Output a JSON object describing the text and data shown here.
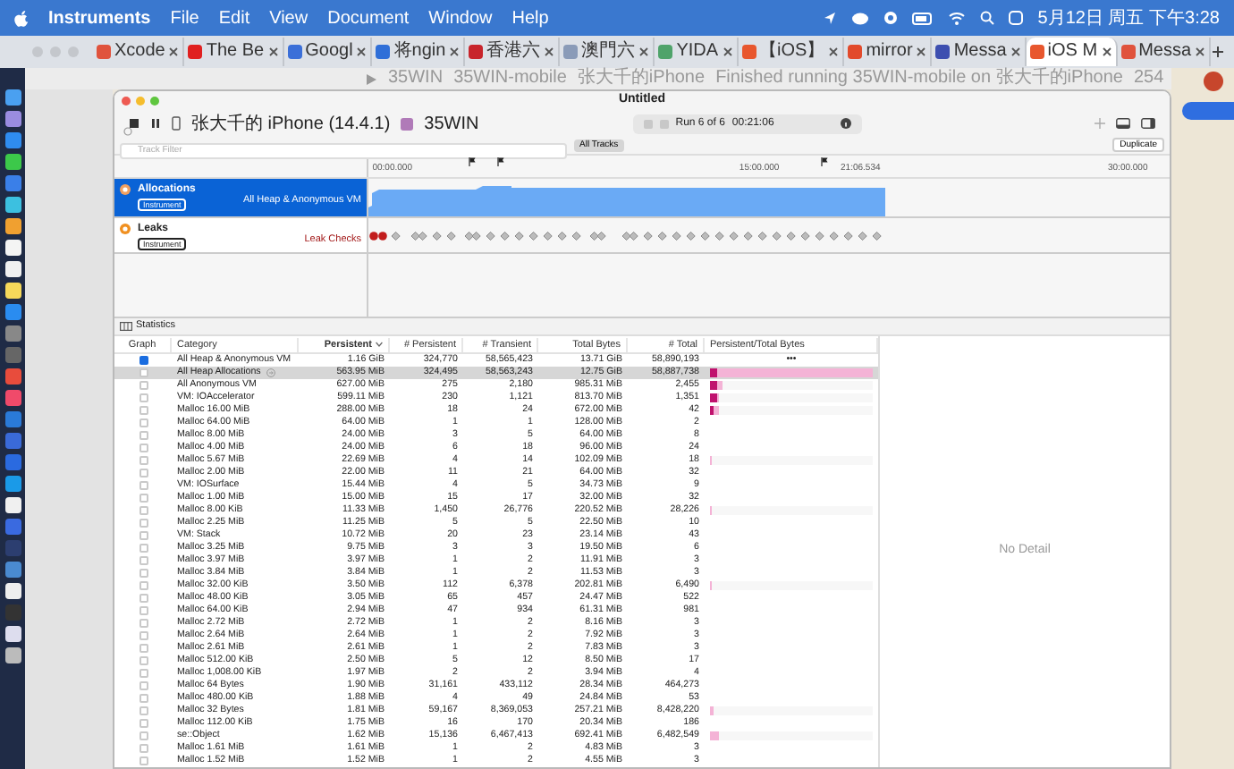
{
  "menu_bar": {
    "app": "Instruments",
    "menus": [
      "File",
      "Edit",
      "View",
      "Document",
      "Window",
      "Help"
    ],
    "clock": "5月12日 周五 下午3:28"
  },
  "browser_tabs": [
    {
      "label": "Xcode",
      "color": "#e0533d",
      "selected": false
    },
    {
      "label": "The Be",
      "color": "#e02020",
      "selected": false
    },
    {
      "label": "Googl",
      "color": "#3b6fd8",
      "selected": false
    },
    {
      "label": "将ngin",
      "color": "#2f6fd8",
      "selected": false
    },
    {
      "label": "香港六",
      "color": "#c8252c",
      "selected": false
    },
    {
      "label": "澳門六",
      "color": "#8a9bb8",
      "selected": false
    },
    {
      "label": "YIDA",
      "color": "#4fa36a",
      "selected": false
    },
    {
      "label": "【iOS】",
      "color": "#e8572e",
      "selected": false
    },
    {
      "label": "mirror",
      "color": "#e24a2b",
      "selected": false
    },
    {
      "label": "Messa",
      "color": "#3d4fb0",
      "selected": false
    },
    {
      "label": "iOS M",
      "color": "#e8572e",
      "selected": true
    },
    {
      "label": "Messa",
      "color": "#e0533d",
      "selected": false
    }
  ],
  "xcode_toolbar": {
    "scheme": "35WIN",
    "breadcrumb": [
      "35WIN-mobile",
      "张大千的iPhone"
    ],
    "status": "Finished running 35WIN-mobile on 张大千的iPhone",
    "warnings": "254"
  },
  "window": {
    "title": "Untitled"
  },
  "toolbar": {
    "device": "张大千的 iPhone (14.4.1)",
    "app": "35WIN",
    "run": "Run 6 of 6",
    "elapsed": "00:21:06"
  },
  "track_filter": {
    "placeholder": "Track Filter"
  },
  "scope_button": "All Tracks",
  "duplicate_button": "Duplicate",
  "ruler": [
    "00:00.000",
    "15:00.000",
    "21:06.534",
    "30:00.000"
  ],
  "tracks": [
    {
      "kind": "allocations",
      "name": "Allocations",
      "badge": "Instrument",
      "label": "All Heap & Anonymous VM",
      "selected": true
    },
    {
      "kind": "leaks",
      "name": "Leaks",
      "badge": "Instrument",
      "label": "Leak Checks",
      "selected": false
    }
  ],
  "detail_view": "Statistics",
  "table": {
    "columns": [
      {
        "label": "Graph",
        "sorted": false
      },
      {
        "label": "Category",
        "sorted": false
      },
      {
        "label": "Persistent",
        "sorted": true
      },
      {
        "label": "# Persistent",
        "sorted": false
      },
      {
        "label": "# Transient",
        "sorted": false
      },
      {
        "label": "Total Bytes",
        "sorted": false
      },
      {
        "label": "# Total",
        "sorted": false
      },
      {
        "label": "Persistent/Total Bytes",
        "sorted": false
      }
    ],
    "rows": [
      {
        "graph_checked": true,
        "selected": false,
        "category": "All Heap & Anonymous VM",
        "persistent": "1.16 GiB",
        "persistent_count": "324,770",
        "transient_count": "58,565,423",
        "total_bytes": "13.71 GiB",
        "total_count": "58,890,193",
        "bar_text": "•••"
      },
      {
        "graph_checked": false,
        "selected": true,
        "category": "All Heap Allocations",
        "persistent": "563.95 MiB",
        "persistent_count": "324,495",
        "transient_count": "58,563,243",
        "total_bytes": "12.75 GiB",
        "total_count": "58,887,738",
        "bar": {
          "persistent": {
            "level": 0.04
          },
          "total": {
            "level": 1
          }
        }
      },
      {
        "graph_checked": false,
        "selected": false,
        "category": "All Anonymous VM",
        "persistent": "627.00 MiB",
        "persistent_count": "275",
        "transient_count": "2,180",
        "total_bytes": "985.31 MiB",
        "total_count": "2,455",
        "bar": {
          "persistent": {
            "level": 0.04
          },
          "total": {
            "level": 0.08
          }
        }
      },
      {
        "graph_checked": false,
        "selected": false,
        "category": "VM: IOAccelerator",
        "persistent": "599.11 MiB",
        "persistent_count": "230",
        "transient_count": "1,121",
        "total_bytes": "813.70 MiB",
        "total_count": "1,351",
        "bar": {
          "persistent": {
            "level": 0.04
          },
          "total": {
            "level": 0.06
          }
        }
      },
      {
        "graph_checked": false,
        "selected": false,
        "category": "Malloc 16.00 MiB",
        "persistent": "288.00 MiB",
        "persistent_count": "18",
        "transient_count": "24",
        "total_bytes": "672.00 MiB",
        "total_count": "42",
        "bar": {
          "persistent": {
            "level": 0.02
          },
          "total": {
            "level": 0.06
          }
        }
      },
      {
        "graph_checked": false,
        "selected": false,
        "category": "Malloc 64.00 MiB",
        "persistent": "64.00 MiB",
        "persistent_count": "1",
        "transient_count": "1",
        "total_bytes": "128.00 MiB",
        "total_count": "2"
      },
      {
        "graph_checked": false,
        "selected": false,
        "category": "Malloc 8.00 MiB",
        "persistent": "24.00 MiB",
        "persistent_count": "3",
        "transient_count": "5",
        "total_bytes": "64.00 MiB",
        "total_count": "8"
      },
      {
        "graph_checked": false,
        "selected": false,
        "category": "Malloc 4.00 MiB",
        "persistent": "24.00 MiB",
        "persistent_count": "6",
        "transient_count": "18",
        "total_bytes": "96.00 MiB",
        "total_count": "24"
      },
      {
        "graph_checked": false,
        "selected": false,
        "category": "Malloc 5.67 MiB",
        "persistent": "22.69 MiB",
        "persistent_count": "4",
        "transient_count": "14",
        "total_bytes": "102.09 MiB",
        "total_count": "18",
        "bar": {
          "total": {
            "level": 0.01
          }
        }
      },
      {
        "graph_checked": false,
        "selected": false,
        "category": "Malloc 2.00 MiB",
        "persistent": "22.00 MiB",
        "persistent_count": "11",
        "transient_count": "21",
        "total_bytes": "64.00 MiB",
        "total_count": "32"
      },
      {
        "graph_checked": false,
        "selected": false,
        "category": "VM: IOSurface",
        "persistent": "15.44 MiB",
        "persistent_count": "4",
        "transient_count": "5",
        "total_bytes": "34.73 MiB",
        "total_count": "9"
      },
      {
        "graph_checked": false,
        "selected": false,
        "category": "Malloc 1.00 MiB",
        "persistent": "15.00 MiB",
        "persistent_count": "15",
        "transient_count": "17",
        "total_bytes": "32.00 MiB",
        "total_count": "32"
      },
      {
        "graph_checked": false,
        "selected": false,
        "category": "Malloc 8.00 KiB",
        "persistent": "11.33 MiB",
        "persistent_count": "1,450",
        "transient_count": "26,776",
        "total_bytes": "220.52 MiB",
        "total_count": "28,226",
        "bar": {
          "total": {
            "level": 0.01
          }
        }
      },
      {
        "graph_checked": false,
        "selected": false,
        "category": "Malloc 2.25 MiB",
        "persistent": "11.25 MiB",
        "persistent_count": "5",
        "transient_count": "5",
        "total_bytes": "22.50 MiB",
        "total_count": "10"
      },
      {
        "graph_checked": false,
        "selected": false,
        "category": "VM: Stack",
        "persistent": "10.72 MiB",
        "persistent_count": "20",
        "transient_count": "23",
        "total_bytes": "23.14 MiB",
        "total_count": "43"
      },
      {
        "graph_checked": false,
        "selected": false,
        "category": "Malloc 3.25 MiB",
        "persistent": "9.75 MiB",
        "persistent_count": "3",
        "transient_count": "3",
        "total_bytes": "19.50 MiB",
        "total_count": "6"
      },
      {
        "graph_checked": false,
        "selected": false,
        "category": "Malloc 3.97 MiB",
        "persistent": "3.97 MiB",
        "persistent_count": "1",
        "transient_count": "2",
        "total_bytes": "11.91 MiB",
        "total_count": "3"
      },
      {
        "graph_checked": false,
        "selected": false,
        "category": "Malloc 3.84 MiB",
        "persistent": "3.84 MiB",
        "persistent_count": "1",
        "transient_count": "2",
        "total_bytes": "11.53 MiB",
        "total_count": "3"
      },
      {
        "graph_checked": false,
        "selected": false,
        "category": "Malloc 32.00 KiB",
        "persistent": "3.50 MiB",
        "persistent_count": "112",
        "transient_count": "6,378",
        "total_bytes": "202.81 MiB",
        "total_count": "6,490",
        "bar": {
          "total": {
            "level": 0.015
          }
        }
      },
      {
        "graph_checked": false,
        "selected": false,
        "category": "Malloc 48.00 KiB",
        "persistent": "3.05 MiB",
        "persistent_count": "65",
        "transient_count": "457",
        "total_bytes": "24.47 MiB",
        "total_count": "522"
      },
      {
        "graph_checked": false,
        "selected": false,
        "category": "Malloc 64.00 KiB",
        "persistent": "2.94 MiB",
        "persistent_count": "47",
        "transient_count": "934",
        "total_bytes": "61.31 MiB",
        "total_count": "981"
      },
      {
        "graph_checked": false,
        "selected": false,
        "category": "Malloc 2.72 MiB",
        "persistent": "2.72 MiB",
        "persistent_count": "1",
        "transient_count": "2",
        "total_bytes": "8.16 MiB",
        "total_count": "3"
      },
      {
        "graph_checked": false,
        "selected": false,
        "category": "Malloc 2.64 MiB",
        "persistent": "2.64 MiB",
        "persistent_count": "1",
        "transient_count": "2",
        "total_bytes": "7.92 MiB",
        "total_count": "3"
      },
      {
        "graph_checked": false,
        "selected": false,
        "category": "Malloc 2.61 MiB",
        "persistent": "2.61 MiB",
        "persistent_count": "1",
        "transient_count": "2",
        "total_bytes": "7.83 MiB",
        "total_count": "3"
      },
      {
        "graph_checked": false,
        "selected": false,
        "category": "Malloc 512.00 KiB",
        "persistent": "2.50 MiB",
        "persistent_count": "5",
        "transient_count": "12",
        "total_bytes": "8.50 MiB",
        "total_count": "17"
      },
      {
        "graph_checked": false,
        "selected": false,
        "category": "Malloc 1,008.00 KiB",
        "persistent": "1.97 MiB",
        "persistent_count": "2",
        "transient_count": "2",
        "total_bytes": "3.94 MiB",
        "total_count": "4"
      },
      {
        "graph_checked": false,
        "selected": false,
        "category": "Malloc 64 Bytes",
        "persistent": "1.90 MiB",
        "persistent_count": "31,161",
        "transient_count": "433,112",
        "total_bytes": "28.34 MiB",
        "total_count": "464,273"
      },
      {
        "graph_checked": false,
        "selected": false,
        "category": "Malloc 480.00 KiB",
        "persistent": "1.88 MiB",
        "persistent_count": "4",
        "transient_count": "49",
        "total_bytes": "24.84 MiB",
        "total_count": "53"
      },
      {
        "graph_checked": false,
        "selected": false,
        "category": "Malloc 32 Bytes",
        "persistent": "1.81 MiB",
        "persistent_count": "59,167",
        "transient_count": "8,369,053",
        "total_bytes": "257.21 MiB",
        "total_count": "8,428,220",
        "bar": {
          "total": {
            "level": 0.02
          }
        }
      },
      {
        "graph_checked": false,
        "selected": false,
        "category": "Malloc 112.00 KiB",
        "persistent": "1.75 MiB",
        "persistent_count": "16",
        "transient_count": "170",
        "total_bytes": "20.34 MiB",
        "total_count": "186"
      },
      {
        "graph_checked": false,
        "selected": false,
        "category": "se::Object",
        "persistent": "1.62 MiB",
        "persistent_count": "15,136",
        "transient_count": "6,467,413",
        "total_bytes": "692.41 MiB",
        "total_count": "6,482,549",
        "bar": {
          "total": {
            "level": 0.05
          }
        }
      },
      {
        "graph_checked": false,
        "selected": false,
        "category": "Malloc 1.61 MiB",
        "persistent": "1.61 MiB",
        "persistent_count": "1",
        "transient_count": "2",
        "total_bytes": "4.83 MiB",
        "total_count": "3"
      },
      {
        "graph_checked": false,
        "selected": false,
        "category": "Malloc 1.52 MiB",
        "persistent": "1.52 MiB",
        "persistent_count": "1",
        "transient_count": "2",
        "total_bytes": "4.55 MiB",
        "total_count": "3"
      }
    ]
  },
  "detail_panel": {
    "text": "No Detail"
  }
}
